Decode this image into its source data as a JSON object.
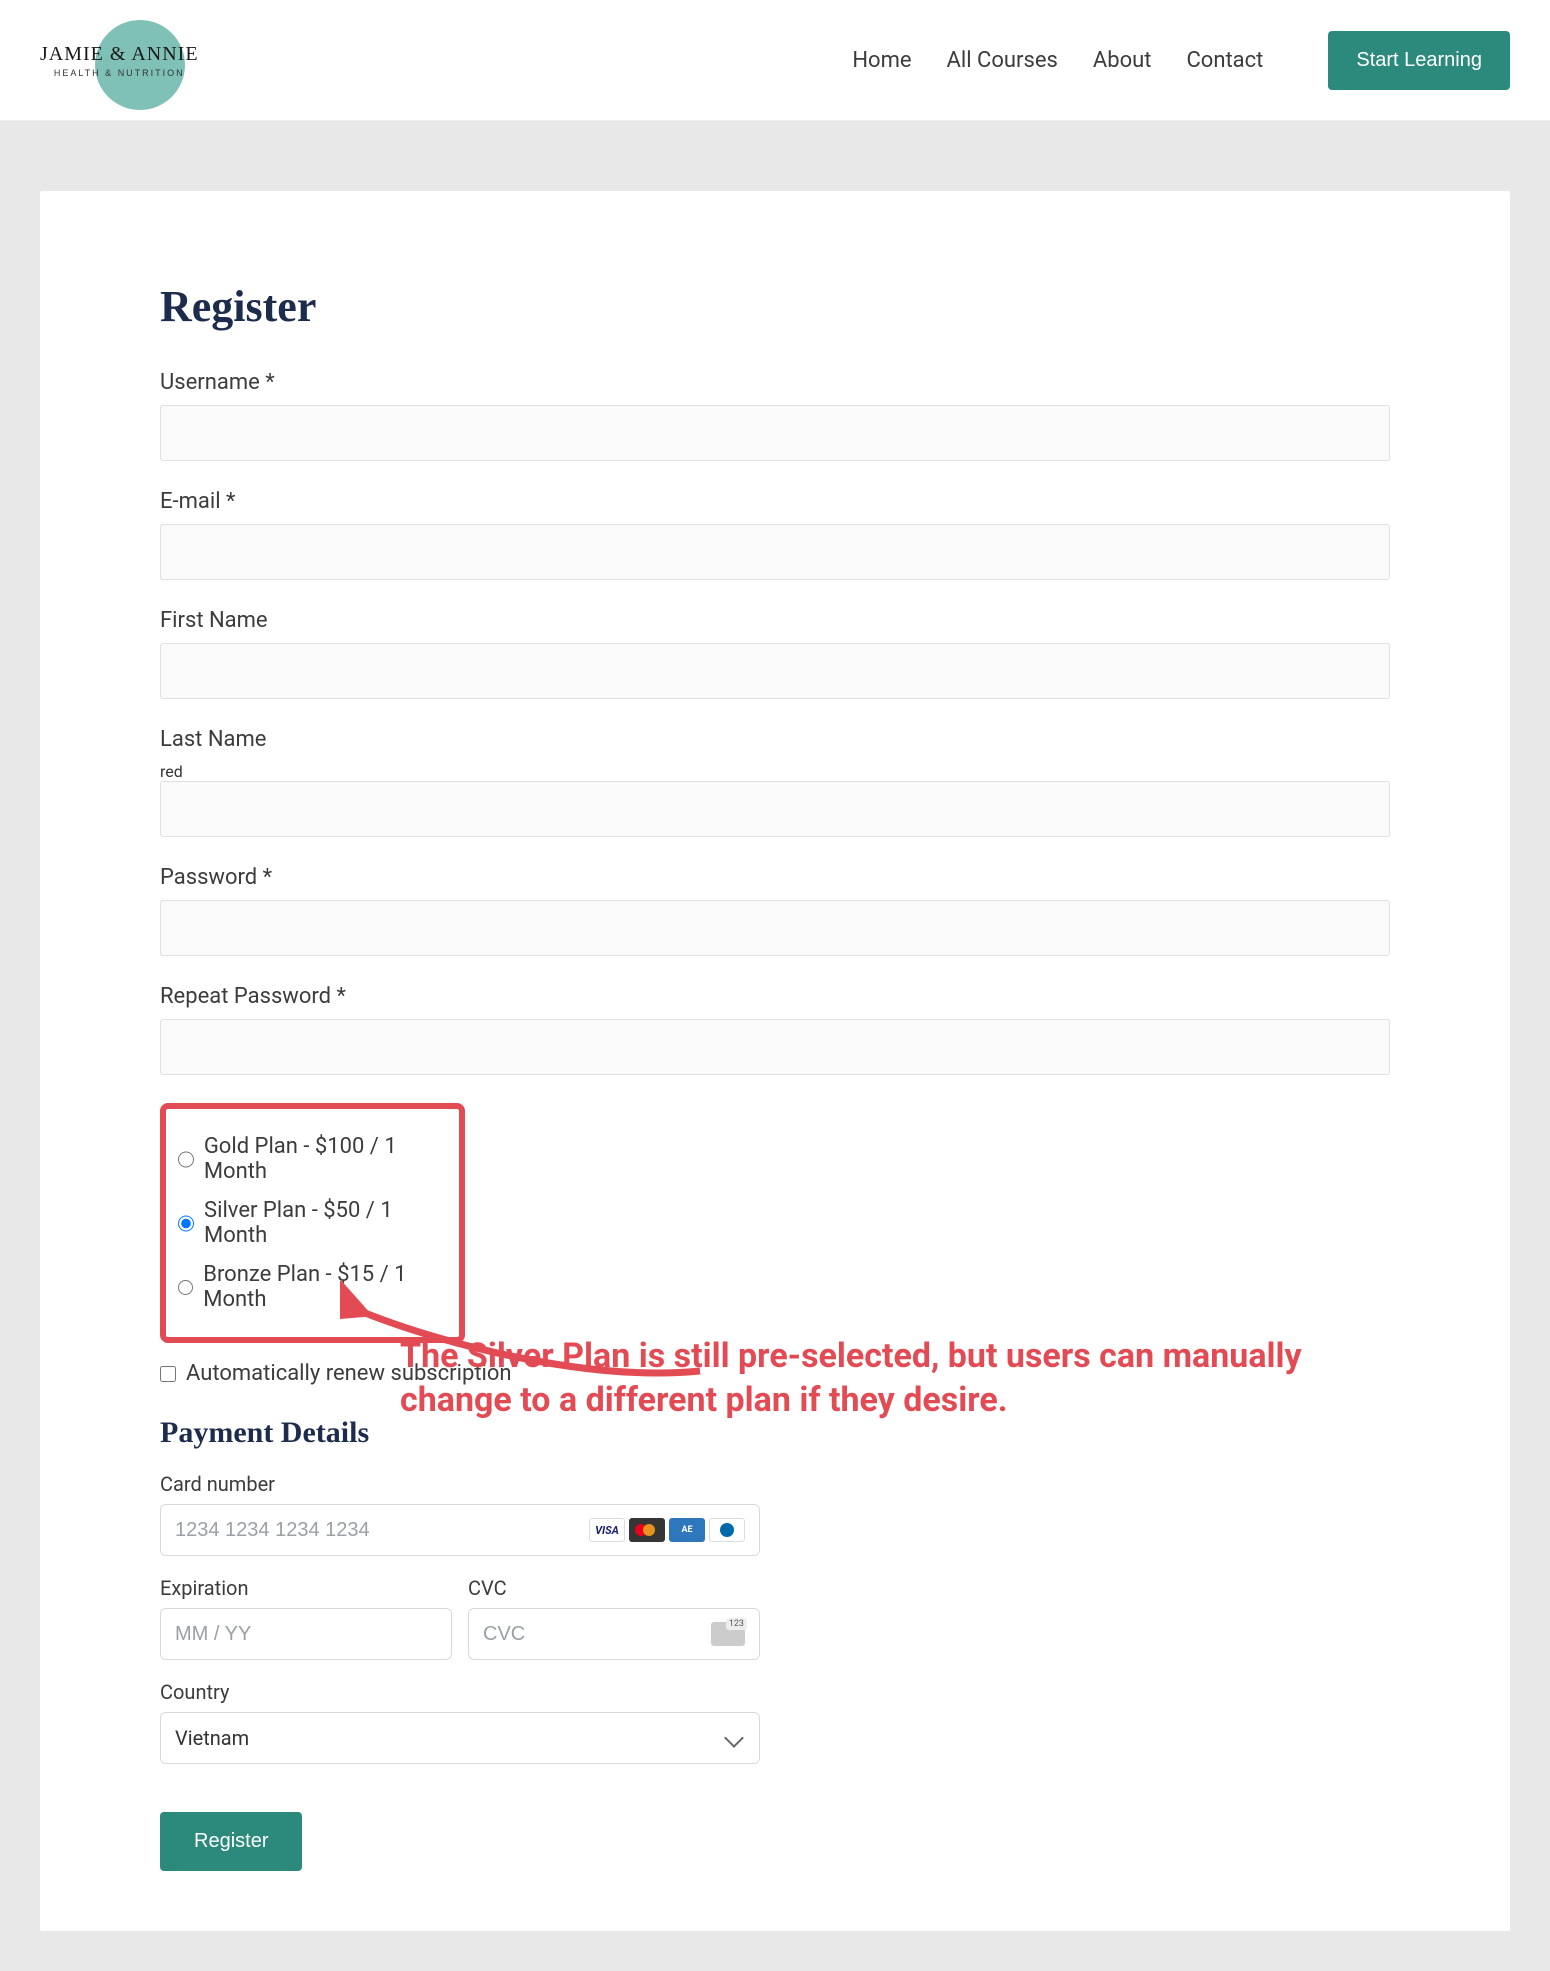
{
  "logo": {
    "main": "JAMIE & ANNIE",
    "sub": "HEALTH & NUTRITION"
  },
  "nav": {
    "home": "Home",
    "courses": "All Courses",
    "about": "About",
    "contact": "Contact",
    "cta": "Start Learning"
  },
  "page": {
    "title": "Register"
  },
  "form": {
    "username_label": "Username *",
    "email_label": "E-mail *",
    "firstname_label": "First Name",
    "lastname_label": "Last Name",
    "password_label": "Password *",
    "repeat_password_label": "Repeat Password *"
  },
  "plans": {
    "gold": "Gold Plan - $100 / 1 Month",
    "silver": "Silver Plan - $50 / 1 Month",
    "bronze": "Bronze Plan - $15 / 1 Month"
  },
  "auto_renew_label": "Automatically renew subscription",
  "payment": {
    "title": "Payment Details",
    "card_label": "Card number",
    "card_placeholder": "1234 1234 1234 1234",
    "exp_label": "Expiration",
    "exp_placeholder": "MM / YY",
    "cvc_label": "CVC",
    "cvc_placeholder": "CVC",
    "country_label": "Country",
    "country_value": "Vietnam"
  },
  "submit_label": "Register",
  "annotation": "The Silver Plan is still pre-selected, but users can manually change to a different plan if they desire."
}
